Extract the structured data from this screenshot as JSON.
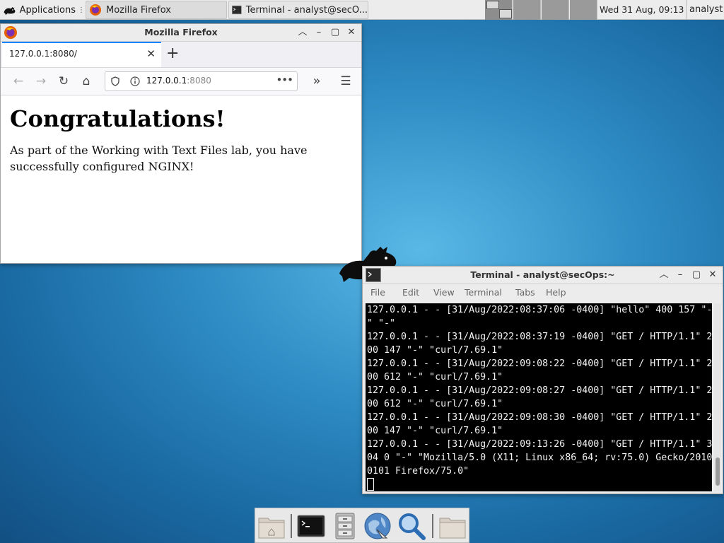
{
  "top_panel": {
    "applications_label": "Applications",
    "tasks": [
      {
        "label": "Mozilla Firefox"
      },
      {
        "label": "Terminal - analyst@secO..."
      }
    ],
    "clock": "Wed 31 Aug, 09:13",
    "user": "analyst"
  },
  "firefox": {
    "window_title": "Mozilla Firefox",
    "tab_label": "127.0.0.1:8080/",
    "url_host": "127.0.0.1",
    "url_port": ":8080",
    "page": {
      "heading": "Congratulations!",
      "paragraph": "As part of the Working with Text Files lab, you have successfully configured NGINX!"
    }
  },
  "terminal": {
    "window_title": "Terminal - analyst@secOps:~",
    "menu": [
      "File",
      "Edit",
      "View",
      "Terminal",
      "Tabs",
      "Help"
    ],
    "lines": [
      "127.0.0.1 - - [31/Aug/2022:08:37:06 -0400] \"hello\" 400 157 \"-",
      "\" \"-\"",
      "127.0.0.1 - - [31/Aug/2022:08:37:19 -0400] \"GET / HTTP/1.1\" 2",
      "00 147 \"-\" \"curl/7.69.1\"",
      "127.0.0.1 - - [31/Aug/2022:09:08:22 -0400] \"GET / HTTP/1.1\" 2",
      "00 612 \"-\" \"curl/7.69.1\"",
      "127.0.0.1 - - [31/Aug/2022:09:08:27 -0400] \"GET / HTTP/1.1\" 2",
      "00 612 \"-\" \"curl/7.69.1\"",
      "127.0.0.1 - - [31/Aug/2022:09:08:30 -0400] \"GET / HTTP/1.1\" 2",
      "00 147 \"-\" \"curl/7.69.1\"",
      "127.0.0.1 - - [31/Aug/2022:09:13:26 -0400] \"GET / HTTP/1.1\" 3",
      "04 0 \"-\" \"Mozilla/5.0 (X11; Linux x86_64; rv:75.0) Gecko/2010",
      "0101 Firefox/75.0\""
    ]
  },
  "dock": {
    "items": [
      "home-folder-icon",
      "terminal-icon",
      "file-manager-icon",
      "web-browser-icon",
      "app-finder-icon",
      "folder-icon"
    ]
  },
  "colors": {
    "firefox_tab_accent": "#0a84ff",
    "terminal_bg": "#000000",
    "terminal_fg": "#f2f2f2",
    "panel_bg": "#ececec"
  }
}
